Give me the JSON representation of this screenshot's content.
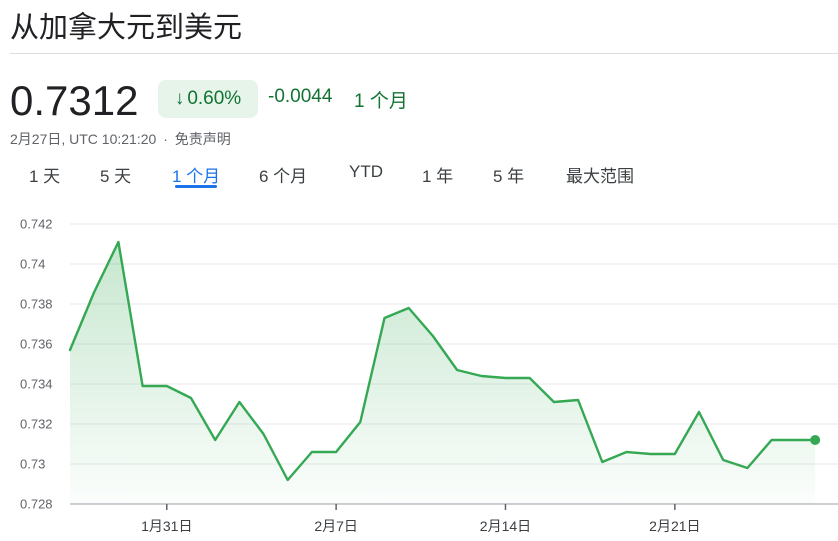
{
  "header": {
    "title": "从加拿大元到美元"
  },
  "quote": {
    "price": "0.7312",
    "change_pct": "0.60%",
    "change_arrow": "↓",
    "change_abs": "-0.0044",
    "change_period": "1 个月",
    "timestamp": "2月27日, UTC 10:21:20",
    "separator": "·",
    "disclaimer": "免责声明"
  },
  "tabs": [
    {
      "label": "1 天"
    },
    {
      "label": "5 天"
    },
    {
      "label": "1 个月",
      "active": true
    },
    {
      "label": "6 个月"
    },
    {
      "label": "YTD"
    },
    {
      "label": "1 年"
    },
    {
      "label": "5 年"
    },
    {
      "label": "最大范围"
    }
  ],
  "colors": {
    "line": "#34a853",
    "positive_text": "#137333",
    "positive_bg": "#e6f4ea",
    "active_tab": "#1a73e8"
  },
  "chart_data": {
    "type": "area",
    "ylim": [
      0.728,
      0.742
    ],
    "yticks": [
      0.742,
      0.74,
      0.738,
      0.736,
      0.734,
      0.732,
      0.73,
      0.728
    ],
    "ytick_labels": [
      "0.742",
      "0.74",
      "0.738",
      "0.736",
      "0.734",
      "0.732",
      "0.73",
      "0.728"
    ],
    "xticks": [
      {
        "day": 31,
        "label": "1月31日"
      },
      {
        "day": 38,
        "label": "2月7日"
      },
      {
        "day": 45,
        "label": "2月14日"
      },
      {
        "day": 52,
        "label": "2月21日"
      }
    ],
    "x_range": [
      27,
      58
    ],
    "grid": true,
    "series": [
      {
        "points": [
          [
            27.0,
            0.7357
          ],
          [
            28.0,
            0.7386
          ],
          [
            29.0,
            0.7411
          ],
          [
            30.0,
            0.7339
          ],
          [
            31.0,
            0.7339
          ],
          [
            32.0,
            0.7333
          ],
          [
            33.0,
            0.7312
          ],
          [
            34.0,
            0.7331
          ],
          [
            35.0,
            0.7315
          ],
          [
            36.0,
            0.7292
          ],
          [
            37.0,
            0.7306
          ],
          [
            38.0,
            0.7306
          ],
          [
            39.0,
            0.7321
          ],
          [
            40.0,
            0.7373
          ],
          [
            41.0,
            0.7378
          ],
          [
            42.0,
            0.7364
          ],
          [
            43.0,
            0.7347
          ],
          [
            44.0,
            0.7344
          ],
          [
            45.0,
            0.7343
          ],
          [
            46.0,
            0.7343
          ],
          [
            47.0,
            0.7331
          ],
          [
            48.0,
            0.7332
          ],
          [
            49.0,
            0.7301
          ],
          [
            50.0,
            0.7306
          ],
          [
            51.0,
            0.7305
          ],
          [
            52.0,
            0.7305
          ],
          [
            53.0,
            0.7326
          ],
          [
            54.0,
            0.7302
          ],
          [
            55.0,
            0.7298
          ],
          [
            56.0,
            0.7312
          ],
          [
            57.8,
            0.7312
          ]
        ]
      }
    ]
  }
}
